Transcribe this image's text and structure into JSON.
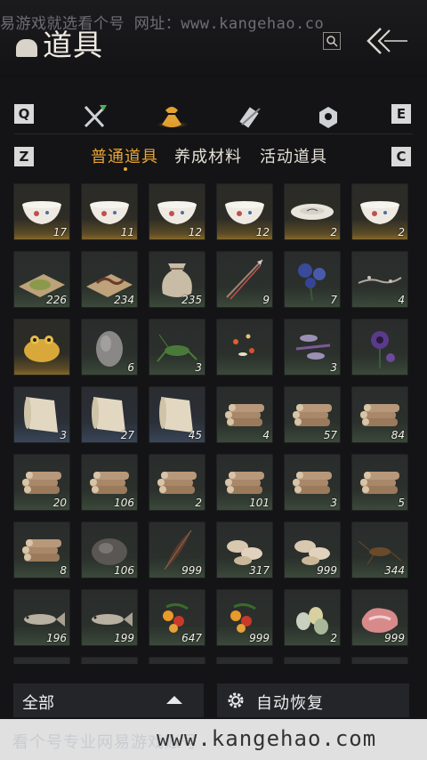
{
  "watermark_top": "易游戏就选看个号 网址：www.kangehao.co",
  "header": {
    "title": "道具"
  },
  "tab_keys": {
    "left": "Q",
    "right": "E"
  },
  "subtab_keys": {
    "left": "Z",
    "right": "C"
  },
  "subtabs": [
    "普通道具",
    "养成材料",
    "活动道具"
  ],
  "items": [
    {
      "icon": "porcelain-bowl-icon",
      "qty": "17"
    },
    {
      "icon": "porcelain-bowl-icon",
      "qty": "11"
    },
    {
      "icon": "porcelain-bowl-icon",
      "qty": "12"
    },
    {
      "icon": "porcelain-bowl-icon",
      "qty": "12"
    },
    {
      "icon": "porcelain-plate-icon",
      "qty": "2"
    },
    {
      "icon": "porcelain-bowl-icon",
      "qty": "2"
    },
    {
      "icon": "herb-powder-icon",
      "qty": "226"
    },
    {
      "icon": "worm-icon",
      "qty": "234"
    },
    {
      "icon": "cloth-sack-icon",
      "qty": "235"
    },
    {
      "icon": "arrows-icon",
      "qty": "9"
    },
    {
      "icon": "blue-flower-icon",
      "qty": "7"
    },
    {
      "icon": "branch-icon",
      "qty": "4"
    },
    {
      "icon": "golden-toad-icon",
      "qty": ""
    },
    {
      "icon": "stone-icon",
      "qty": "6"
    },
    {
      "icon": "cricket-icon",
      "qty": "3"
    },
    {
      "icon": "fireflies-icon",
      "qty": ""
    },
    {
      "icon": "dragonfly-icon",
      "qty": "3"
    },
    {
      "icon": "purple-flower-icon",
      "qty": ""
    },
    {
      "icon": "scroll-icon",
      "qty": "3"
    },
    {
      "icon": "scroll-icon",
      "qty": "27"
    },
    {
      "icon": "scroll-icon",
      "qty": "45"
    },
    {
      "icon": "log-bundle-icon",
      "qty": "4"
    },
    {
      "icon": "log-bundle-icon",
      "qty": "57"
    },
    {
      "icon": "log-bundle-icon",
      "qty": "84"
    },
    {
      "icon": "log-bundle-icon",
      "qty": "20"
    },
    {
      "icon": "log-bundle-icon",
      "qty": "106"
    },
    {
      "icon": "log-bundle-icon",
      "qty": "2"
    },
    {
      "icon": "log-bundle-icon",
      "qty": "101"
    },
    {
      "icon": "log-bundle-icon",
      "qty": "3"
    },
    {
      "icon": "log-bundle-icon",
      "qty": "5"
    },
    {
      "icon": "log-bundle-icon",
      "qty": "8"
    },
    {
      "icon": "ore-icon",
      "qty": "106"
    },
    {
      "icon": "feather-icon",
      "qty": "999"
    },
    {
      "icon": "mushroom-icon",
      "qty": "317"
    },
    {
      "icon": "mushroom-icon",
      "qty": "999"
    },
    {
      "icon": "insect-icon",
      "qty": "344"
    },
    {
      "icon": "fish-icon",
      "qty": "196"
    },
    {
      "icon": "fish-icon",
      "qty": "199"
    },
    {
      "icon": "berries-icon",
      "qty": "647"
    },
    {
      "icon": "berries-icon",
      "qty": "999"
    },
    {
      "icon": "eggs-icon",
      "qty": "2"
    },
    {
      "icon": "meat-icon",
      "qty": "999"
    }
  ],
  "filter": {
    "label": "全部"
  },
  "auto_restore": {
    "label": "自动恢复"
  },
  "watermark_bottom": {
    "cn": "看个号专业网易游戏账号",
    "url": "www.kangehao.com"
  }
}
